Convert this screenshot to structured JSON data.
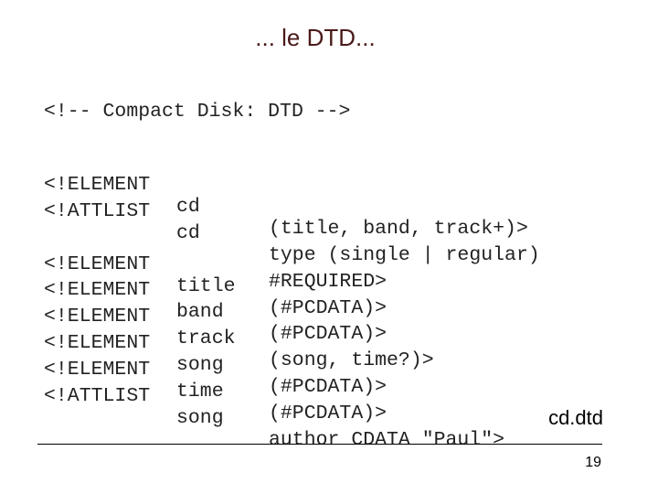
{
  "slide": {
    "title": "... le DTD...",
    "comment": "<!-- Compact Disk: DTD -->",
    "declarations": [
      {
        "keyword": "<!ELEMENT",
        "name": "cd",
        "content": "(title, band, track+)>"
      },
      {
        "keyword": "<!ATTLIST",
        "name": "cd",
        "content": "type (single | regular)"
      },
      {
        "keyword": "",
        "name": "",
        "content": "#REQUIRED>"
      },
      {
        "keyword": "<!ELEMENT",
        "name": "title",
        "content": "(#PCDATA)>"
      },
      {
        "keyword": "<!ELEMENT",
        "name": "band",
        "content": "(#PCDATA)>"
      },
      {
        "keyword": "<!ELEMENT",
        "name": "track",
        "content": "(song, time?)>"
      },
      {
        "keyword": "<!ELEMENT",
        "name": "song",
        "content": "(#PCDATA)>"
      },
      {
        "keyword": "<!ELEMENT",
        "name": "time",
        "content": "(#PCDATA)>"
      },
      {
        "keyword": "<!ATTLIST",
        "name": "song",
        "content": "author CDATA \"Paul\">"
      }
    ],
    "filename": "cd.dtd",
    "page_number": "19"
  },
  "colors": {
    "title": "#4a1a1a",
    "text": "#222222",
    "background": "#ffffff"
  }
}
